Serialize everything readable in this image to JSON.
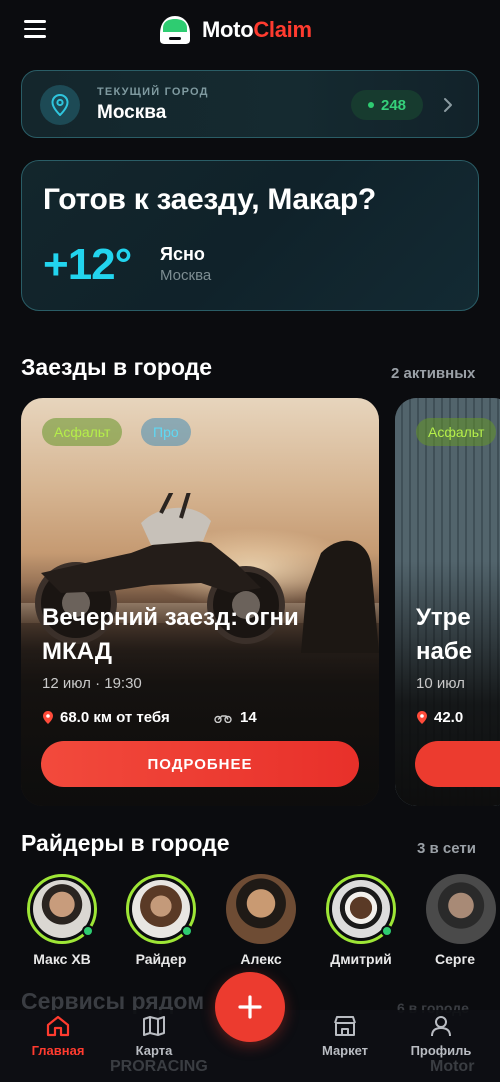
{
  "app": {
    "name_part1": "Moto",
    "name_part2": "Claim"
  },
  "city": {
    "label": "ТЕКУЩИЙ ГОРОД",
    "name": "Москва",
    "online_count": "248"
  },
  "weather": {
    "greeting": "Готов к заезду, Макар?",
    "temperature": "+12°",
    "condition": "Ясно",
    "city": "Москва"
  },
  "rides_section": {
    "title": "Заезды в городе",
    "meta": "2 активных"
  },
  "rides": [
    {
      "tags": [
        "Асфальт",
        "Про"
      ],
      "title": "Вечерний заезд: огни МКАД",
      "date": "12 июл · 19:30",
      "distance": "68.0 км от тебя",
      "riders": "14",
      "button": "ПОДРОБНЕЕ"
    },
    {
      "tags": [
        "Асфальт"
      ],
      "title": "Утре набе",
      "date": "10 июл",
      "distance": "42.0"
    }
  ],
  "riders_section": {
    "title": "Райдеры в городе",
    "meta": "3 в сети"
  },
  "riders": [
    {
      "name": "Макс ХВ",
      "online": true
    },
    {
      "name": "Райдер",
      "online": true
    },
    {
      "name": "Алекс",
      "online": false
    },
    {
      "name": "Дмитрий",
      "online": true
    },
    {
      "name": "Серге",
      "online": false
    }
  ],
  "services_section": {
    "title": "Сервисы рядом",
    "meta": "6 в городе"
  },
  "ghost_labels": [
    "PRORACING",
    "Motor"
  ],
  "nav": {
    "home": "Главная",
    "map": "Карта",
    "market": "Маркет",
    "profile": "Профиль"
  },
  "colors": {
    "accent": "#ff3b2f",
    "teal": "#22d4ee",
    "online": "#2ecc71",
    "lime": "#9ee636"
  }
}
